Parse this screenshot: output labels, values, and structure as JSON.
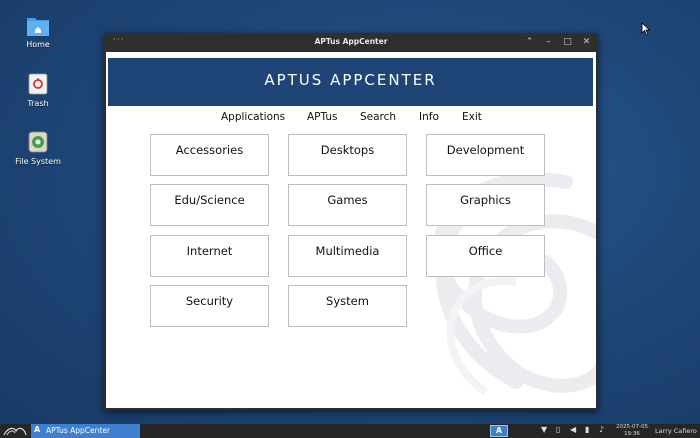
{
  "desktop": {
    "icons": [
      {
        "label": "Home",
        "icon": "home-folder-icon"
      },
      {
        "label": "Trash",
        "icon": "trash-icon"
      },
      {
        "label": "File System",
        "icon": "drive-icon"
      }
    ]
  },
  "window": {
    "title": "APTus AppCenter",
    "menu_dots": "···",
    "buttons": {
      "collapse": "⌃",
      "minimize": "–",
      "maximize": "□",
      "close": "✕"
    }
  },
  "banner": {
    "title": "APTUS APPCENTER"
  },
  "menu": {
    "items": [
      "Applications",
      "APTus",
      "Search",
      "Info",
      "Exit"
    ]
  },
  "categories": [
    "Accessories",
    "Desktops",
    "Development",
    "Edu/Science",
    "Games",
    "Graphics",
    "Internet",
    "Multimedia",
    "Office",
    "Security",
    "System"
  ],
  "taskbar": {
    "task_label": "APTus AppCenter",
    "task_glyph": "A",
    "app_glyph": "A",
    "date": "2025-07-05",
    "time": "19:36",
    "user": "Larry Cafiero"
  },
  "colors": {
    "desktop": "#1e4576",
    "banner": "#1f4578",
    "task_active": "#3f7fd0"
  }
}
